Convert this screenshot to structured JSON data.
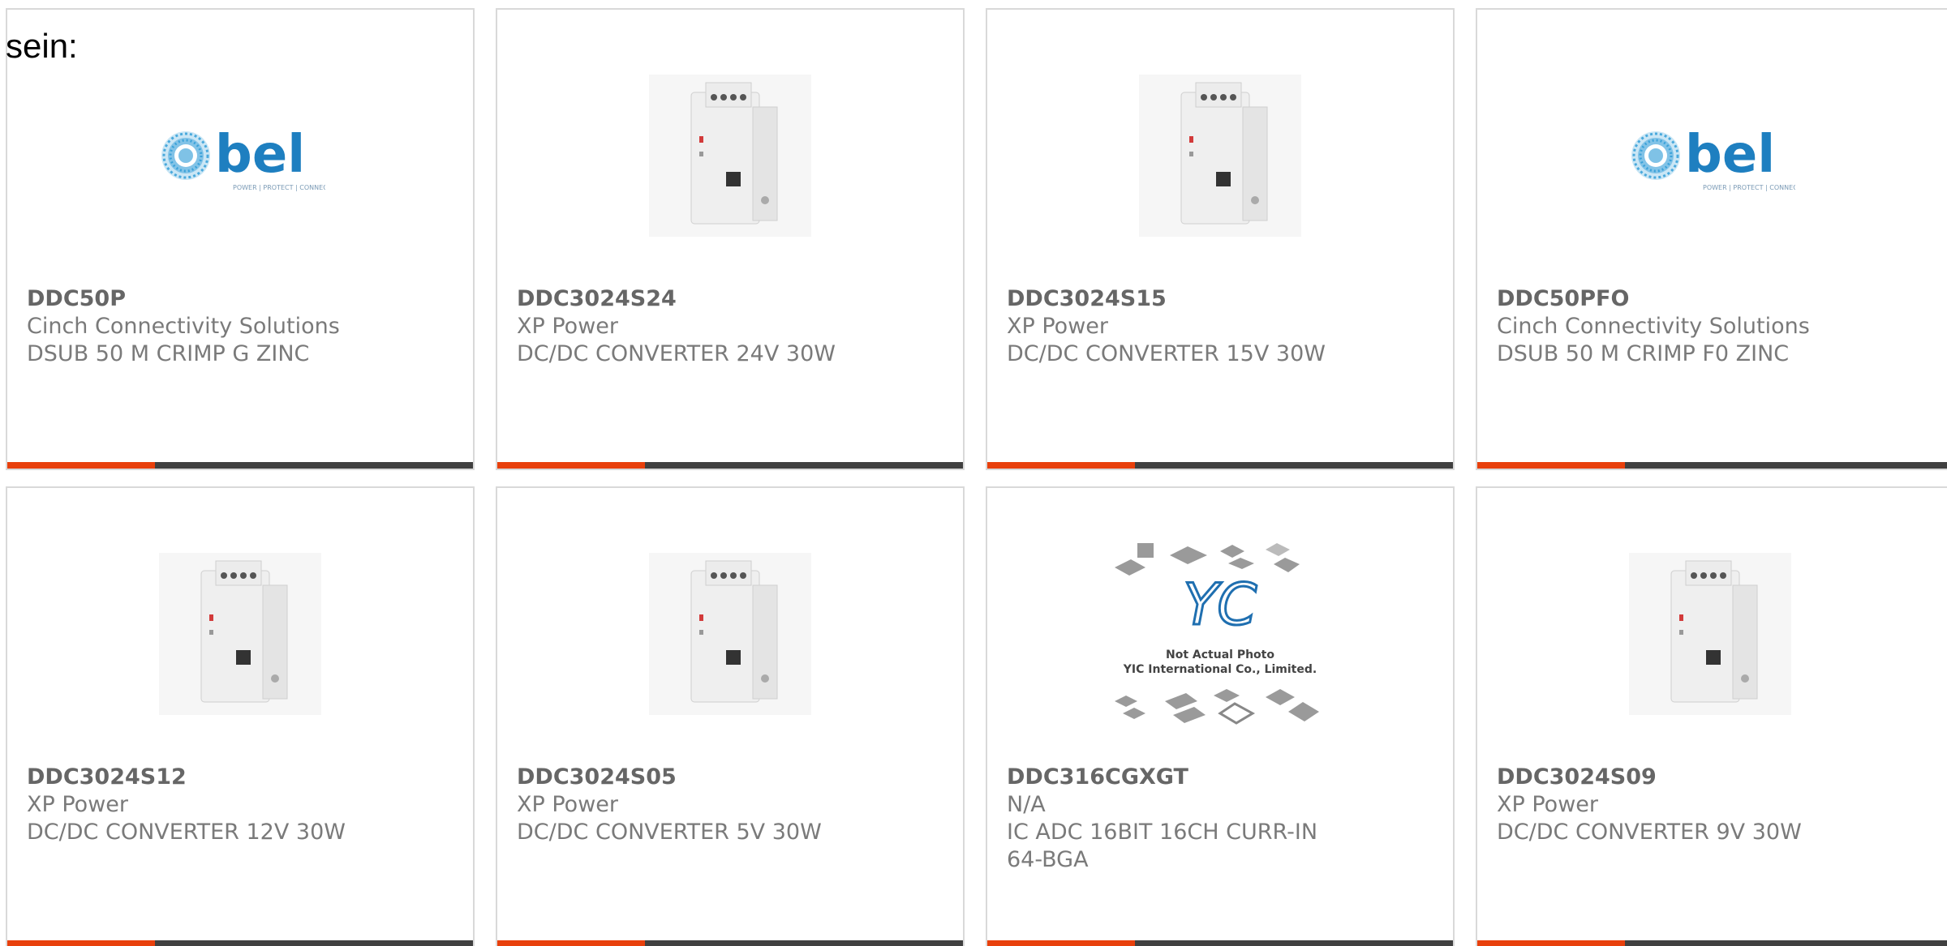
{
  "intro_text": "sein:",
  "colors": {
    "accent": "#e8400c",
    "bar_dark": "#404040",
    "text": "#7a7a7a",
    "bel_blue": "#1f8fcf"
  },
  "products": [
    {
      "part": "DDC50P",
      "manufacturer": "Cinch Connectivity Solutions",
      "description": "DSUB 50 M CRIMP G ZINC",
      "image": "bel-logo",
      "logo_text": "bel",
      "logo_tagline": "POWER | PROTECT | CONNECT"
    },
    {
      "part": "DDC3024S24",
      "manufacturer": "XP Power",
      "description": "DC/DC CONVERTER 24V 30W",
      "image": "din-rail-module"
    },
    {
      "part": "DDC3024S15",
      "manufacturer": "XP Power",
      "description": "DC/DC CONVERTER 15V 30W",
      "image": "din-rail-module"
    },
    {
      "part": "DDC50PFO",
      "manufacturer": "Cinch Connectivity Solutions",
      "description": "DSUB 50 M CRIMP F0 ZINC",
      "image": "bel-logo",
      "logo_text": "bel",
      "logo_tagline": "POWER | PROTECT | CONNECT"
    },
    {
      "part": "DDC3024S12",
      "manufacturer": "XP Power",
      "description": "DC/DC CONVERTER 12V 30W",
      "image": "din-rail-module"
    },
    {
      "part": "DDC3024S05",
      "manufacturer": "XP Power",
      "description": "DC/DC CONVERTER 5V 30W",
      "image": "din-rail-module"
    },
    {
      "part": "DDC316CGXGT",
      "manufacturer": "N/A",
      "description": "IC ADC 16BIT 16CH CURR-IN 64-BGA",
      "image": "yic-placeholder",
      "placeholder_line1": "Not Actual Photo",
      "placeholder_line2": "YIC International Co., Limited."
    },
    {
      "part": "DDC3024S09",
      "manufacturer": "XP Power",
      "description": "DC/DC CONVERTER 9V 30W",
      "image": "din-rail-module"
    }
  ]
}
